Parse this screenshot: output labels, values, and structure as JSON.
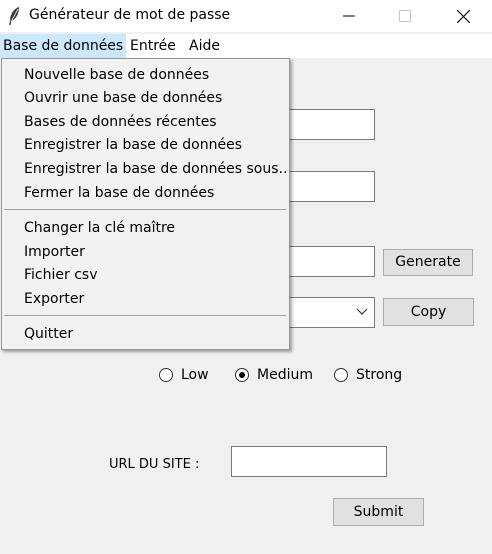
{
  "window": {
    "title": "Générateur de mot de passe",
    "icon": "feather-icon",
    "controls": [
      "minimize-icon",
      "maximize-icon",
      "close-icon"
    ]
  },
  "menubar": {
    "items": [
      {
        "label": "Base de données",
        "active": true
      },
      {
        "label": "Entrée",
        "active": false
      },
      {
        "label": "Aide",
        "active": false
      }
    ]
  },
  "dropdown": {
    "group1": [
      "Nouvelle base de données",
      "Ouvrir une base de données",
      "Bases de données récentes",
      "Enregistrer la base de données",
      "Enregistrer la base de données sous..",
      "Fermer la base de données"
    ],
    "group2": [
      "Changer la clé maître",
      "Importer",
      "Fichier csv",
      "Exporter"
    ],
    "group3": [
      "Quitter"
    ]
  },
  "form": {
    "generate_label": "Generate",
    "copy_label": "Copy",
    "strength_options": [
      {
        "label": "Low",
        "selected": false
      },
      {
        "label": "Medium",
        "selected": true
      },
      {
        "label": "Strong",
        "selected": false
      }
    ],
    "url_label": "URL DU SITE :",
    "url_value": "",
    "submit_label": "Submit"
  },
  "colors": {
    "menu_highlight": "#cce8ff",
    "window_bg": "#f0f0f0",
    "button_bg": "#e1e1e1"
  }
}
